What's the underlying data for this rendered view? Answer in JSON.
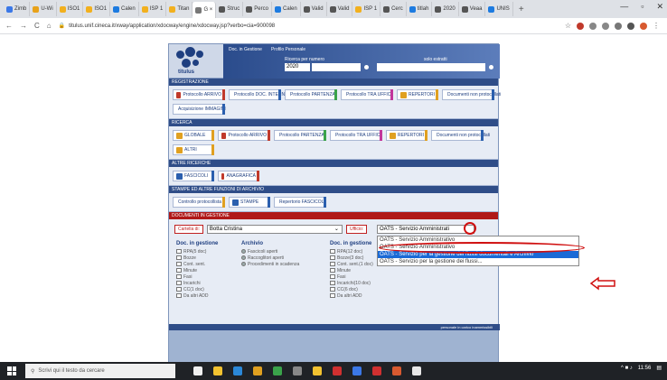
{
  "browser": {
    "tabs": [
      {
        "label": "Zimb",
        "color": "#3b78e7"
      },
      {
        "label": "U-Wi",
        "color": "#e8a21a"
      },
      {
        "label": "ISO1",
        "color": "#f2b01e"
      },
      {
        "label": "ISO1",
        "color": "#f2b01e"
      },
      {
        "label": "Calen",
        "color": "#1d7be0"
      },
      {
        "label": "ISP 1",
        "color": "#f2b01e"
      },
      {
        "label": "Titan",
        "color": "#f2b01e"
      },
      {
        "label": "G ×",
        "color": "#777777",
        "active": true
      },
      {
        "label": "Struc",
        "color": "#555555"
      },
      {
        "label": "Perco",
        "color": "#555555"
      },
      {
        "label": "Calen",
        "color": "#1d7be0"
      },
      {
        "label": "Valid",
        "color": "#555555"
      },
      {
        "label": "Valid",
        "color": "#555555"
      },
      {
        "label": "ISP 1",
        "color": "#f2b01e"
      },
      {
        "label": "Cerc",
        "color": "#555555"
      },
      {
        "label": "titlah",
        "color": "#1d7be0"
      },
      {
        "label": "2020",
        "color": "#555555"
      },
      {
        "label": "Veaa",
        "color": "#555555"
      },
      {
        "label": "UNIS",
        "color": "#1d7be0"
      }
    ],
    "plus": "+",
    "url": "titulus.unif.cineca.it/xway/application/xdocway/engine/xdocway.jsp?verbo=cia=900098"
  },
  "header": {
    "logo_text": "titulus",
    "link_doc": "Doc. in Gestione",
    "link_profile": "Profilo Personale",
    "ricerca_label": "Ricerca per numero",
    "year": "2020",
    "solo_label": "solo estratti"
  },
  "sections": [
    {
      "title": "Registrazione",
      "buttons": [
        {
          "label": "Protocollo ARRIVO",
          "color": "#c0392b"
        },
        {
          "label": "Protocollo DOC. INTERNO",
          "color": "#2b5fae"
        },
        {
          "label": "Protocollo PARTENZA",
          "color": "#3aa34a"
        },
        {
          "label": "Protocollo TRA UFFICI",
          "color": "#c2369b"
        },
        {
          "label": "REPERTORI",
          "color": "#e0a020"
        },
        {
          "label": "Documenti non protocollati",
          "color": "#2b5fae"
        },
        {
          "label": "Acquisizione IMMAGINI",
          "color": "#2b5fae"
        }
      ]
    },
    {
      "title": "Ricerca",
      "buttons": [
        {
          "label": "GLOBALE",
          "color": "#e0a020"
        },
        {
          "label": "Protocollo ARRIVO",
          "color": "#c0392b"
        },
        {
          "label": "Protocollo PARTENZA",
          "color": "#3aa34a"
        },
        {
          "label": "Protocollo TRA UFFICI",
          "color": "#c2369b"
        },
        {
          "label": "REPERTORI",
          "color": "#e0a020"
        },
        {
          "label": "Documenti non protocollati",
          "color": "#2b5fae"
        },
        {
          "label": "ALTRI",
          "color": "#e0a020"
        }
      ]
    },
    {
      "title": "Altre ricerche",
      "buttons": [
        {
          "label": "FASCICOLI",
          "color": "#2b5fae"
        },
        {
          "label": "ANAGRAFICA",
          "color": "#c0392b"
        }
      ]
    },
    {
      "title": "Stampe ed altre funzioni di archivio",
      "buttons": [
        {
          "label": "Controllo protocollista",
          "color": "#e0a020"
        },
        {
          "label": "STAMPE",
          "color": "#2b5fae"
        },
        {
          "label": "Repertorio FASCICOLI",
          "color": "#2b5fae"
        }
      ]
    }
  ],
  "docs": {
    "title": "Documenti in gestione",
    "cartella_label": "Cartella di:",
    "cartella_value": "Botta Cristina",
    "ufficio_label": "Ufficio:",
    "ufficio_value": "OATS - Servizio Amministrati",
    "dropdown": [
      "OATS - Servizio Amministrativo",
      "OATS - Servizio Amministrativo",
      "OATS - Servizio per la gestione dei flussi documentali e Archivio",
      "OATS - Servizio per la gestione dei flussi..."
    ],
    "dropdown_selected": 2,
    "col1_title": "Doc. in gestione",
    "col1_items": [
      "RPA(5 doc)",
      "Bozze",
      "Cont. sent.",
      "Minute",
      "Fasi",
      "Incarichi",
      "CC(1 doc)",
      "Da altri ADD"
    ],
    "col2_title": "Archivio",
    "col2_items": [
      "Fascicoli aperti",
      "Raccoglitori aperti",
      "Procedimenti in scadenza"
    ],
    "col3_title": "Doc. in gestione",
    "col3_items": [
      "RPA(12 doc)",
      "Bozze(3 doc)",
      "Cont. sent.(1 doc)",
      "Minute",
      "Fasi",
      "Incarichi(10 doc)",
      "CC(6 doc)",
      "Da altri ADD"
    ],
    "col4_items": [
      "Raccoglitori aperti"
    ],
    "footer": "personale in carico   inammissibili"
  },
  "taskbar": {
    "search_placeholder": "Scrivi qui il testo da cercare",
    "time": "11:56",
    "icons": [
      "#f0f0f0",
      "#f2c230",
      "#2b88d8",
      "#e0a020",
      "#3aa34a",
      "#888888",
      "#f2c230",
      "#d03030",
      "#3b78e7",
      "#d03030",
      "#d85a30",
      "#e8e8e8"
    ]
  },
  "colors": {
    "annotation_red": "#d01010",
    "dropdown_highlight": "#1a6ad6",
    "panel_blue": "#2f4d88"
  }
}
